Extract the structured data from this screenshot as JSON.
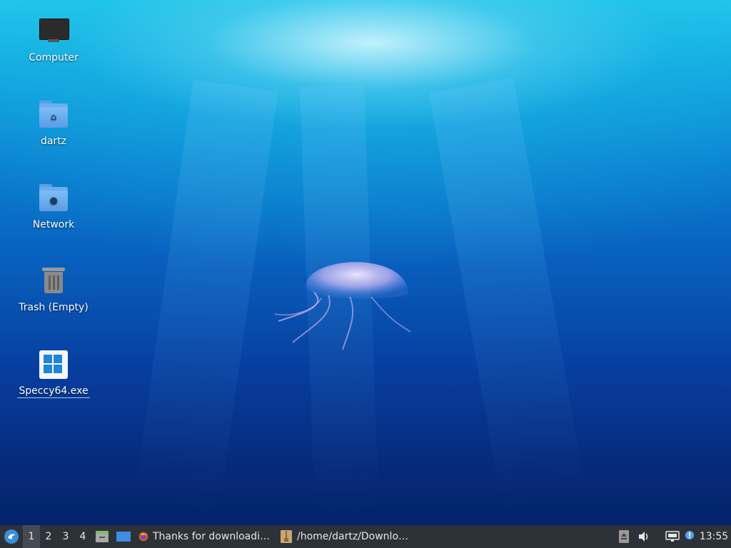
{
  "desktop": {
    "icons": [
      {
        "label": "Computer",
        "icon": "computer-icon"
      },
      {
        "label": "dartz",
        "icon": "home-folder-icon"
      },
      {
        "label": "Network",
        "icon": "network-folder-icon"
      },
      {
        "label": "Trash (Empty)",
        "icon": "trash-icon"
      },
      {
        "label": "Speccy64.exe",
        "icon": "windows-exe-icon"
      }
    ]
  },
  "taskbar": {
    "menu_icon": "whisker-menu-icon",
    "workspaces": [
      "1",
      "2",
      "3",
      "4"
    ],
    "active_workspace": "1",
    "launchers": [
      "file-manager-icon",
      "show-desktop-icon"
    ],
    "tasks": [
      {
        "label": "Thanks for downloadi…",
        "icon": "firefox-icon"
      },
      {
        "label": "/home/dartz/Downlo…",
        "icon": "archive-icon"
      }
    ],
    "tray": [
      "eject-icon",
      "volume-icon",
      "network-icon",
      "notification-icon"
    ],
    "clock": "13:55"
  },
  "colors": {
    "taskbar_bg": "#2d3238",
    "desktop_top": "#22c6ea",
    "desktop_bottom": "#05226a",
    "folder_blue": "#6aaef0",
    "windows_blue": "#1f86d9"
  }
}
